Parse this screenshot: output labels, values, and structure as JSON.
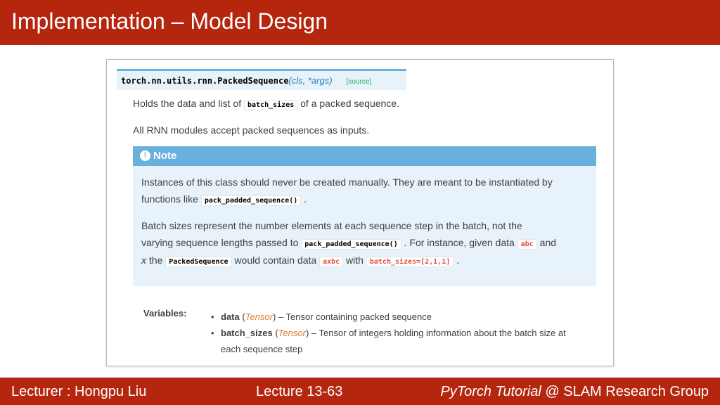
{
  "slide": {
    "title": "Implementation – Model Design",
    "footer": {
      "lecturer": "Lecturer : Hongpu Liu",
      "lecture": "Lecture 13-63",
      "brand_italic": "PyTorch Tutorial",
      "brand_rest": " @ SLAM Research Group"
    }
  },
  "doc": {
    "signature": {
      "name": "torch.nn.utils.rnn.PackedSequence",
      "params": "(cls, *args)",
      "source": "[source]"
    },
    "line1_pre": "Holds the data and list of ",
    "line1_code": "batch_sizes",
    "line1_post": " of a packed sequence.",
    "line2": "All RNN modules accept packed sequences as inputs.",
    "note": {
      "icon": "!",
      "label": "Note",
      "p1_l1": "Instances of this class should never be created manually. They are meant to be instantiated by",
      "p1_l2_pre": "functions like ",
      "p1_l2_code": "pack_padded_sequence()",
      "p1_l2_post": " .",
      "p2_l1": "Batch sizes represent the number elements at each sequence step in the batch, not the",
      "p2_l2_pre": "varying sequence lengths passed to ",
      "p2_l2_code": "pack_padded_sequence()",
      "p2_l2_mid": " . For instance, given data ",
      "p2_l2_code2": "abc",
      "p2_l2_post": " and",
      "p2_l3_x": "x",
      "p2_l3_pre": " the ",
      "p2_l3_code": "PackedSequence",
      "p2_l3_mid": " would contain data ",
      "p2_l3_code2": "axbc",
      "p2_l3_mid2": " with ",
      "p2_l3_code3": "batch_sizes=[2,1,1]",
      "p2_l3_post": " ."
    },
    "variables": {
      "label": "Variables:",
      "items": [
        {
          "bullet": "•",
          "name": "data",
          "open": " (",
          "type": "Tensor",
          "close": ")",
          "desc": " – Tensor containing packed sequence"
        },
        {
          "bullet": "•",
          "name": "batch_sizes",
          "open": " (",
          "type": "Tensor",
          "close": ")",
          "desc": " – Tensor of integers holding information about the batch size at",
          "desc2": "each sequence step"
        }
      ]
    }
  },
  "colors": {
    "header_bg": "#B5260F",
    "note_head": "#6ab0de",
    "note_bg": "#e7f2fa",
    "code_red": "#E74C3C",
    "source_green": "#27ae60"
  }
}
